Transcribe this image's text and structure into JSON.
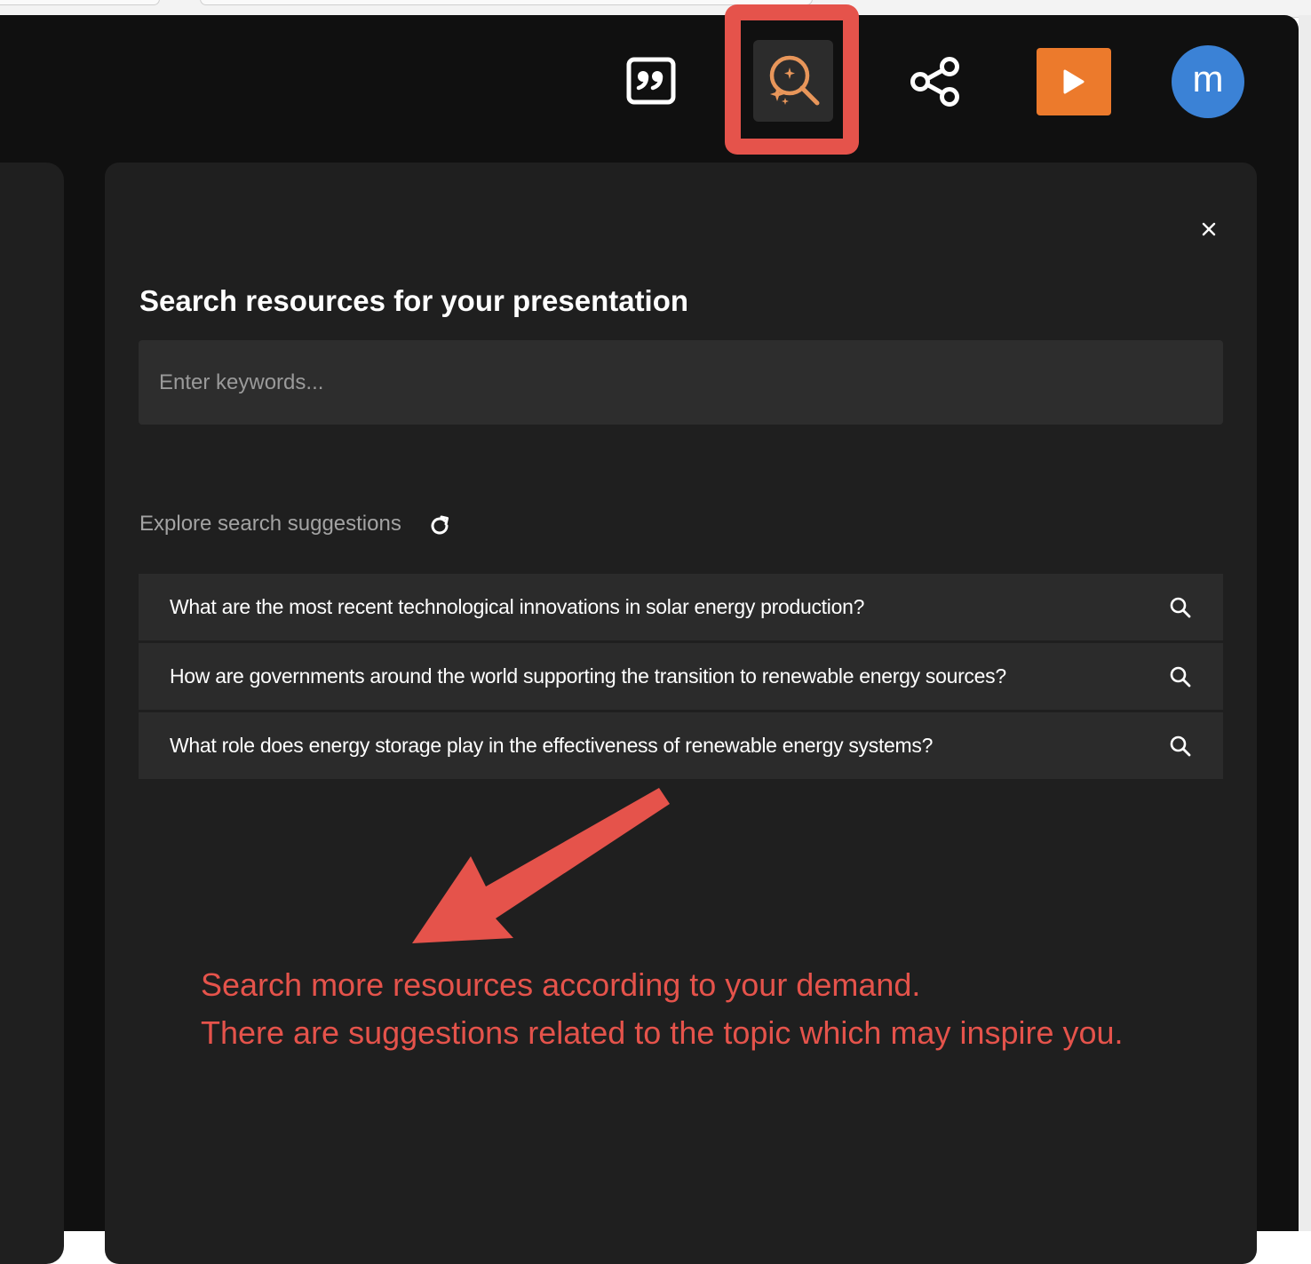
{
  "toolbar": {
    "quote_icon": "quote-icon",
    "research_icon": "sparkle-search-icon",
    "share_icon": "share-icon",
    "present_icon": "play-icon",
    "avatar_initial": "m",
    "colors": {
      "present_button": "#ec7a2c",
      "avatar": "#3b82d6",
      "research_icon": "#e8965a",
      "highlight": "#e5534b"
    }
  },
  "research_panel": {
    "title": "Search resources for your presentation",
    "search_placeholder": "Enter keywords...",
    "suggestions_label": "Explore search suggestions",
    "suggestions": [
      "What are the most recent technological innovations in solar energy production?",
      "How are governments around the world supporting the transition to renewable energy sources?",
      "What role does energy storage play in the effectiveness of renewable energy systems?"
    ]
  },
  "annotation": {
    "line1": "Search more resources according to your demand.",
    "line2": "There are suggestions related to the topic which may inspire you.",
    "color": "#e5534b"
  }
}
